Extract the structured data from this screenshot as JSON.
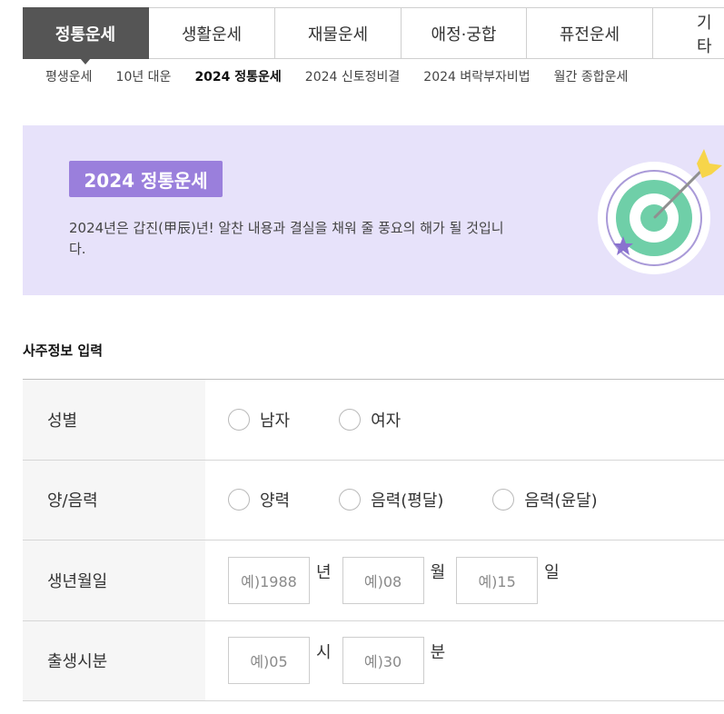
{
  "tabs": [
    {
      "label": "정통운세",
      "active": true
    },
    {
      "label": "생활운세",
      "active": false
    },
    {
      "label": "재물운세",
      "active": false
    },
    {
      "label": "애정·궁합",
      "active": false
    },
    {
      "label": "퓨전운세",
      "active": false
    },
    {
      "label": "기타",
      "active": false
    }
  ],
  "subtabs": [
    {
      "label": "평생운세",
      "active": false
    },
    {
      "label": "10년 대운",
      "active": false
    },
    {
      "label": "2024 정통운세",
      "active": true
    },
    {
      "label": "2024 신토정비결",
      "active": false
    },
    {
      "label": "2024 벼락부자비법",
      "active": false
    },
    {
      "label": "월간 종합운세",
      "active": false
    }
  ],
  "banner": {
    "title": "2024 정통운세",
    "description": "2024년은 갑진(甲辰)년! 알찬 내용과 결실을 채워 줄 풍요의 해가 될 것입니다.",
    "icon": "target-arrow-icon",
    "colors": {
      "background": "#e7e2fa",
      "badge": "#9a7fdc",
      "target": "#6fcfa8",
      "arrow": "#f7d54a"
    }
  },
  "form": {
    "section_title": "사주정보 입력",
    "gender": {
      "label": "성별",
      "options": [
        "남자",
        "여자"
      ]
    },
    "calendar": {
      "label": "양/음력",
      "options": [
        "양력",
        "음력(평달)",
        "음력(윤달)"
      ]
    },
    "birthdate": {
      "label": "생년월일",
      "year_placeholder": "예)1988",
      "year_unit": "년",
      "month_placeholder": "예)08",
      "month_unit": "월",
      "day_placeholder": "예)15",
      "day_unit": "일"
    },
    "birthtime": {
      "label": "출생시분",
      "hour_placeholder": "예)05",
      "hour_unit": "시",
      "minute_placeholder": "예)30",
      "minute_unit": "분"
    }
  }
}
